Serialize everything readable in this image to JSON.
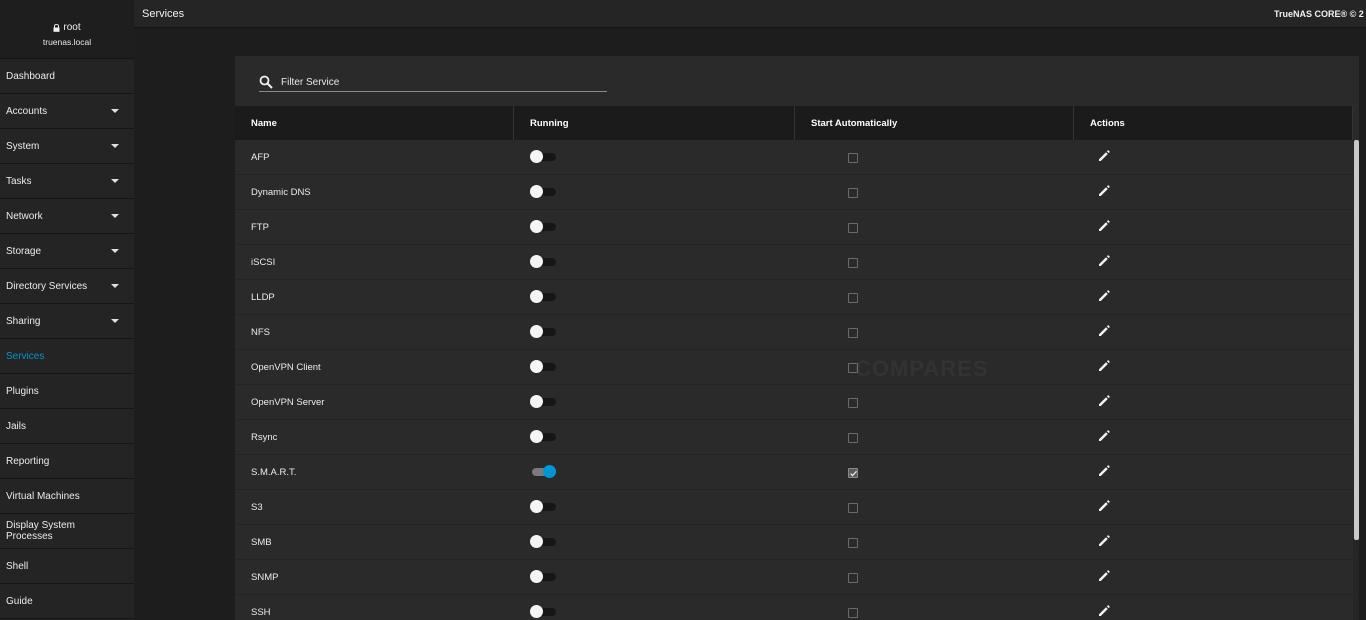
{
  "user": {
    "name": "root",
    "host": "truenas.local"
  },
  "topbar": {
    "title": "Services",
    "brand": "TrueNAS CORE® © 2"
  },
  "nav": [
    {
      "label": "Dashboard",
      "expandable": false,
      "active": false
    },
    {
      "label": "Accounts",
      "expandable": true,
      "active": false
    },
    {
      "label": "System",
      "expandable": true,
      "active": false
    },
    {
      "label": "Tasks",
      "expandable": true,
      "active": false
    },
    {
      "label": "Network",
      "expandable": true,
      "active": false
    },
    {
      "label": "Storage",
      "expandable": true,
      "active": false
    },
    {
      "label": "Directory Services",
      "expandable": true,
      "active": false
    },
    {
      "label": "Sharing",
      "expandable": true,
      "active": false
    },
    {
      "label": "Services",
      "expandable": false,
      "active": true
    },
    {
      "label": "Plugins",
      "expandable": false,
      "active": false
    },
    {
      "label": "Jails",
      "expandable": false,
      "active": false
    },
    {
      "label": "Reporting",
      "expandable": false,
      "active": false
    },
    {
      "label": "Virtual Machines",
      "expandable": false,
      "active": false
    },
    {
      "label": "Display System Processes",
      "expandable": false,
      "active": false
    },
    {
      "label": "Shell",
      "expandable": false,
      "active": false
    },
    {
      "label": "Guide",
      "expandable": false,
      "active": false
    }
  ],
  "filter": {
    "placeholder": "Filter Service"
  },
  "table": {
    "columns": [
      "Name",
      "Running",
      "Start Automatically",
      "Actions"
    ],
    "rows": [
      {
        "name": "AFP",
        "running": false,
        "auto": false
      },
      {
        "name": "Dynamic DNS",
        "running": false,
        "auto": false
      },
      {
        "name": "FTP",
        "running": false,
        "auto": false
      },
      {
        "name": "iSCSI",
        "running": false,
        "auto": false
      },
      {
        "name": "LLDP",
        "running": false,
        "auto": false
      },
      {
        "name": "NFS",
        "running": false,
        "auto": false
      },
      {
        "name": "OpenVPN Client",
        "running": false,
        "auto": false
      },
      {
        "name": "OpenVPN Server",
        "running": false,
        "auto": false
      },
      {
        "name": "Rsync",
        "running": false,
        "auto": false
      },
      {
        "name": "S.M.A.R.T.",
        "running": true,
        "auto": true
      },
      {
        "name": "S3",
        "running": false,
        "auto": false
      },
      {
        "name": "SMB",
        "running": false,
        "auto": false
      },
      {
        "name": "SNMP",
        "running": false,
        "auto": false
      },
      {
        "name": "SSH",
        "running": false,
        "auto": false
      }
    ]
  },
  "colors": {
    "accent": "#0095d5",
    "sidebar": "#242424",
    "card": "#2a2a2a",
    "header": "#1b1b1b"
  },
  "watermark": "COMPARES"
}
